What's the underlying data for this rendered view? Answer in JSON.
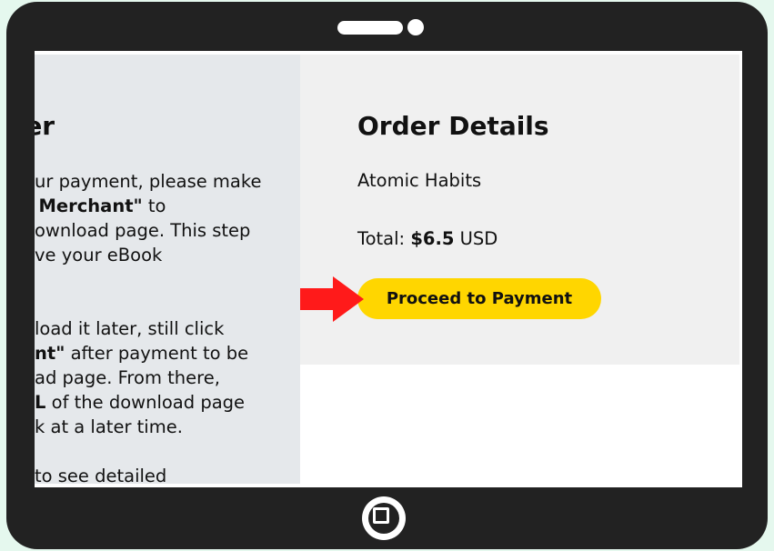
{
  "reminder": {
    "title_partial": "minder",
    "paragraph1": [
      {
        "text": "ur payment, please make",
        "bold": ""
      },
      {
        "text": "",
        "bold": "n to Merchant\"",
        "after": " to"
      },
      {
        "text": "ownload page. This step",
        "bold": ""
      },
      {
        "text": "ve your eBook",
        "bold": ""
      }
    ],
    "p1_line1": "ur payment, please make",
    "p1_line2_bold": "n to Merchant\"",
    "p1_line2_rest": " to",
    "p1_line3": "ownload page. This step",
    "p1_line4": "ve your eBook",
    "p2_line1": "load it later, still click",
    "p2_line2_bold": "nt\"",
    "p2_line2_rest": " after payment to be",
    "p2_line3": "ad page. From there,",
    "p2_line4_bold": "L",
    "p2_line4_rest": " of the download page",
    "p2_line5": "k at a later time.",
    "p3_line1": "to see detailed"
  },
  "order": {
    "title": "Order Details",
    "product_name": "Atomic Habits",
    "total_label": "Total: ",
    "total_amount": "$6.5",
    "total_currency": " USD",
    "pay_button_label": "Proceed to Payment"
  },
  "colors": {
    "button": "#ffd600",
    "arrow": "#ff1a1a",
    "device": "#222222",
    "left_panel": "#e5e8eb",
    "right_panel": "#f0f0f0"
  }
}
